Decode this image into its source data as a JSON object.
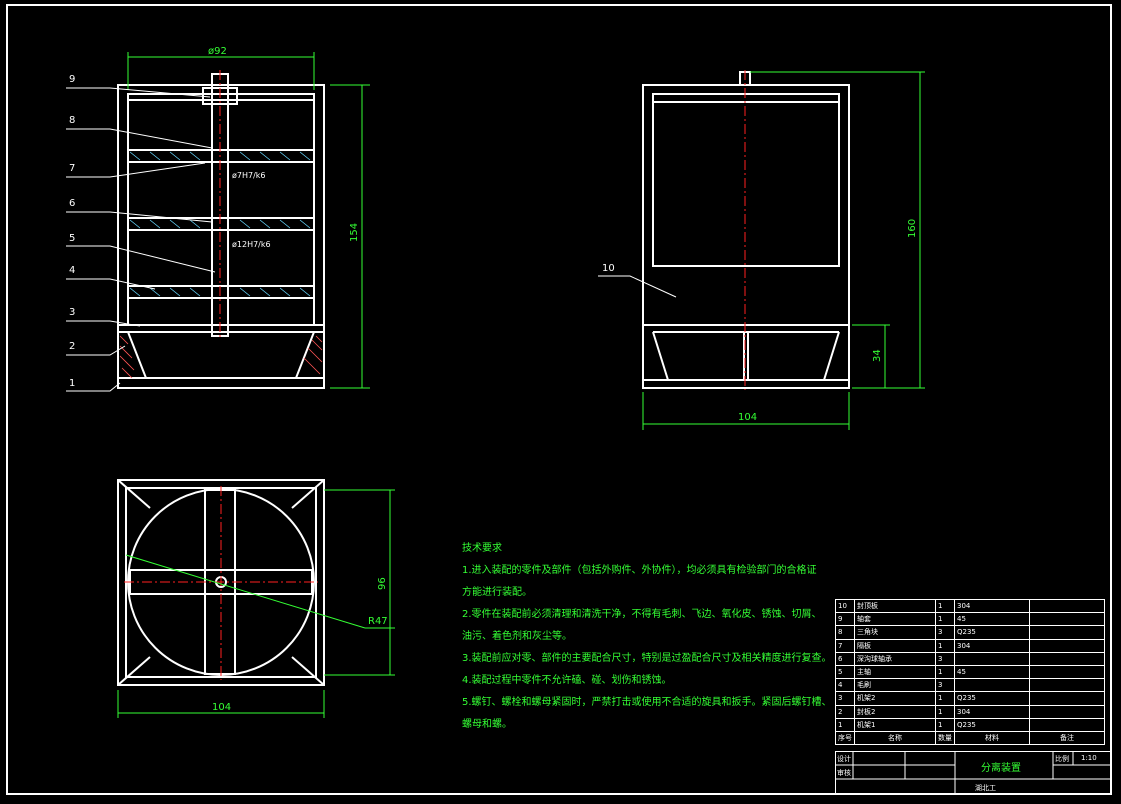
{
  "drawing": {
    "dimensions": {
      "top_width": "ø92",
      "left_height": "154",
      "shaft_fit_upper": "ø7H7/k6",
      "shaft_fit_lower": "ø12H7/k6",
      "right_height": "160",
      "right_base_height": "34",
      "right_width": "104",
      "bottom_width": "104",
      "bottom_height": "96",
      "radius": "R47"
    },
    "balloons": [
      "9",
      "8",
      "7",
      "6",
      "5",
      "4",
      "3",
      "2",
      "1"
    ],
    "right_balloon": "10"
  },
  "notes": {
    "title": "技术要求",
    "lines": [
      "1.进入装配的零件及部件（包括外购件、外协件），均必须具有检验部门的合格证",
      "方能进行装配。",
      "2.零件在装配前必须清理和清洗干净，不得有毛刺、飞边、氧化皮、锈蚀、切屑、",
      "油污、着色剂和灰尘等。",
      "3.装配前应对零、部件的主要配合尺寸，特别是过盈配合尺寸及相关精度进行复查。",
      "4.装配过程中零件不允许磕、碰、划伤和锈蚀。",
      "5.螺钉、螺栓和螺母紧固时，严禁打击或使用不合适的旋具和扳手。紧固后螺钉槽、",
      "螺母和螺。"
    ]
  },
  "bom": {
    "rows": [
      {
        "no": "10",
        "name": "封顶板",
        "qty": "1",
        "material": "304"
      },
      {
        "no": "9",
        "name": "轴套",
        "qty": "1",
        "material": "45"
      },
      {
        "no": "8",
        "name": "三角块",
        "qty": "3",
        "material": "Q235"
      },
      {
        "no": "7",
        "name": "隔板",
        "qty": "1",
        "material": "304"
      },
      {
        "no": "6",
        "name": "深沟球轴承",
        "qty": "3",
        "material": ""
      },
      {
        "no": "5",
        "name": "主轴",
        "qty": "1",
        "material": "45"
      },
      {
        "no": "4",
        "name": "毛刷",
        "qty": "3",
        "material": ""
      },
      {
        "no": "3",
        "name": "机架2",
        "qty": "1",
        "material": "Q235"
      },
      {
        "no": "2",
        "name": "封板2",
        "qty": "1",
        "material": "304"
      },
      {
        "no": "1",
        "name": "机架1",
        "qty": "1",
        "material": "Q235"
      }
    ],
    "header": {
      "no": "序号",
      "name": "名称",
      "qty": "数量",
      "material": "材料",
      "remark": "备注"
    }
  },
  "title_block": {
    "design_label": "设计",
    "review_label": "审核",
    "title": "分离装置",
    "scale_label": "比例",
    "scale": "1:10",
    "company": "湖北工"
  }
}
